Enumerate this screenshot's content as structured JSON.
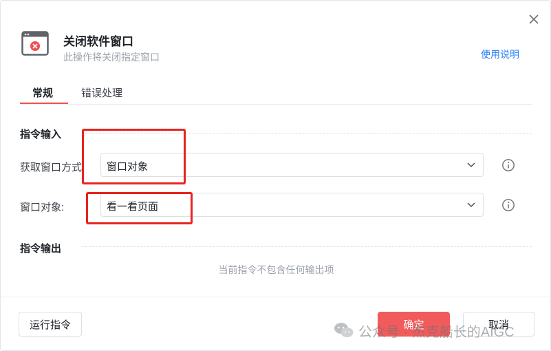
{
  "dialog": {
    "title": "关闭软件窗口",
    "subtitle": "此操作将关闭指定窗口",
    "help_link": "使用说明"
  },
  "tabs": [
    {
      "label": "常规",
      "active": true
    },
    {
      "label": "错误处理",
      "active": false
    }
  ],
  "input_section": {
    "title": "指令输入",
    "fields": [
      {
        "label": "获取窗口方式:",
        "value": "窗口对象"
      },
      {
        "label": "窗口对象:",
        "value": "看一看页面"
      }
    ]
  },
  "output_section": {
    "title": "指令输出",
    "empty_text": "当前指令不包含任何输出项"
  },
  "footer": {
    "run_label": "运行指令",
    "ok_label": "确定",
    "cancel_label": "取消"
  },
  "watermark": {
    "text": "公众号 · 杰克船长的AIGC"
  },
  "colors": {
    "accent": "#f24e4e",
    "primary_button": "#f25b5b",
    "link": "#2d7ff9",
    "highlight_box": "#e8231e"
  },
  "icons": [
    "close-icon",
    "window-close-app-icon",
    "chevron-down-icon",
    "info-icon",
    "wechat-icon"
  ]
}
